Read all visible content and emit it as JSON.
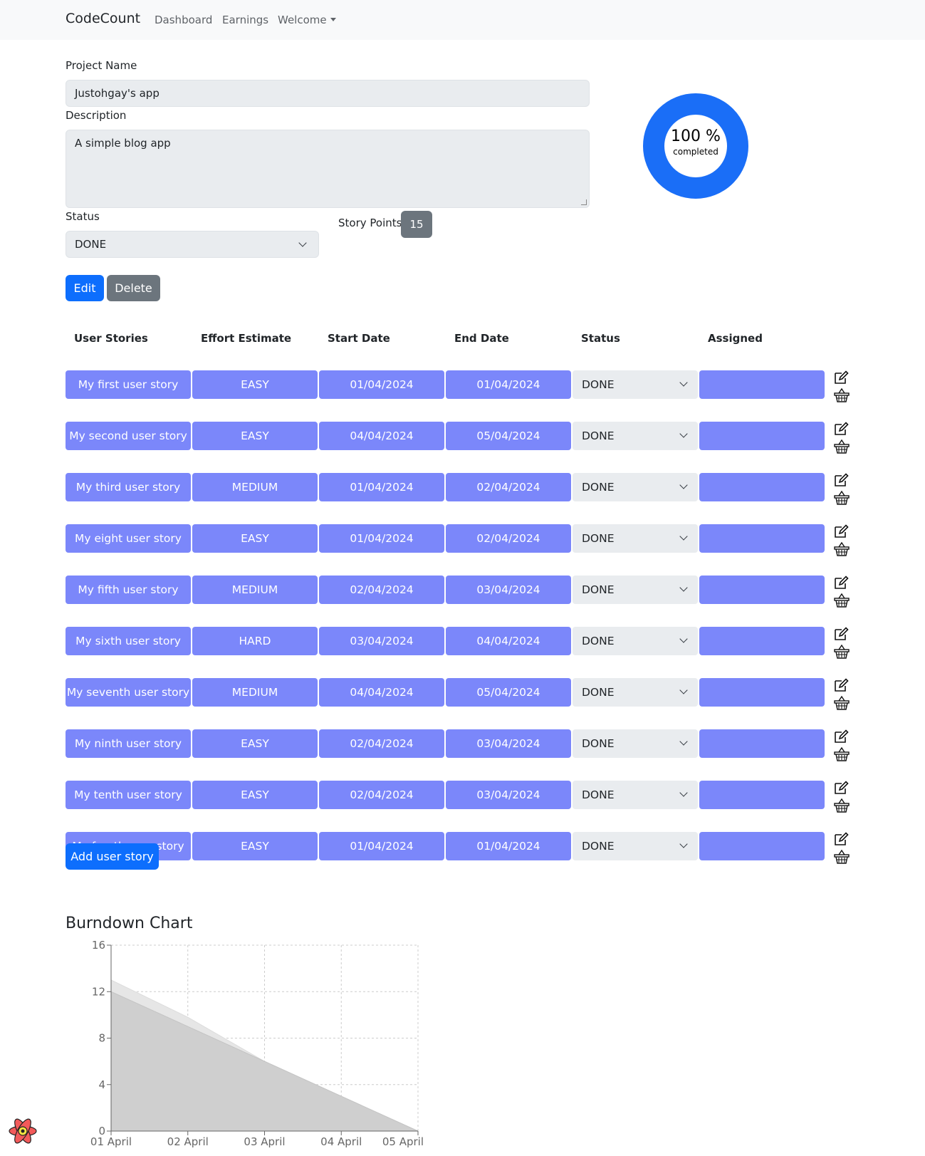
{
  "navbar": {
    "brand": "CodeCount",
    "links": [
      "Dashboard",
      "Earnings"
    ],
    "dropdown": "Welcome"
  },
  "project": {
    "name_label": "Project Name",
    "name_value": "Justohgay's app",
    "description_label": "Description",
    "description_value": "A simple blog app",
    "status_label": "Status",
    "status_value": "DONE",
    "story_points_label": "Story Points",
    "story_points_value": "15",
    "edit_label": "Edit",
    "delete_label": "Delete"
  },
  "progress": {
    "percent": 100,
    "percent_text": "100 %",
    "sub_text": "completed",
    "color": "#1a6ef7"
  },
  "table": {
    "headers": [
      "User Stories",
      "Effort Estimate",
      "Start Date",
      "End Date",
      "Status",
      "Assigned"
    ],
    "rows": [
      {
        "story": "My first user story",
        "effort": "EASY",
        "start": "01/04/2024",
        "end": "01/04/2024",
        "status": "DONE",
        "assigned": ""
      },
      {
        "story": "My second user story",
        "effort": "EASY",
        "start": "04/04/2024",
        "end": "05/04/2024",
        "status": "DONE",
        "assigned": ""
      },
      {
        "story": "My third user story",
        "effort": "MEDIUM",
        "start": "01/04/2024",
        "end": "02/04/2024",
        "status": "DONE",
        "assigned": ""
      },
      {
        "story": "My eight user story",
        "effort": "EASY",
        "start": "01/04/2024",
        "end": "02/04/2024",
        "status": "DONE",
        "assigned": ""
      },
      {
        "story": "My fifth user story",
        "effort": "MEDIUM",
        "start": "02/04/2024",
        "end": "03/04/2024",
        "status": "DONE",
        "assigned": ""
      },
      {
        "story": "My sixth user story",
        "effort": "HARD",
        "start": "03/04/2024",
        "end": "04/04/2024",
        "status": "DONE",
        "assigned": ""
      },
      {
        "story": "My seventh user story",
        "effort": "MEDIUM",
        "start": "04/04/2024",
        "end": "05/04/2024",
        "status": "DONE",
        "assigned": ""
      },
      {
        "story": "My ninth user story",
        "effort": "EASY",
        "start": "02/04/2024",
        "end": "03/04/2024",
        "status": "DONE",
        "assigned": ""
      },
      {
        "story": "My tenth user story",
        "effort": "EASY",
        "start": "02/04/2024",
        "end": "03/04/2024",
        "status": "DONE",
        "assigned": ""
      },
      {
        "story": "My fourth user story",
        "effort": "EASY",
        "start": "01/04/2024",
        "end": "01/04/2024",
        "status": "DONE",
        "assigned": ""
      }
    ],
    "row_icons": [
      "edit-icon",
      "basket-icon"
    ],
    "add_label": "Add user story"
  },
  "chart_data": {
    "type": "area",
    "title": "Burndown Chart",
    "x": [
      "01 April",
      "02 April",
      "03 April",
      "04 April",
      "05 April"
    ],
    "series": [
      {
        "values": [
          13,
          9.8,
          6,
          3,
          0
        ],
        "color": "#e6e6e6"
      },
      {
        "values": [
          12,
          9,
          6,
          3,
          0
        ],
        "color": "#cfcfcf"
      }
    ],
    "yticks": [
      0,
      4,
      8,
      12,
      16
    ],
    "ylim": [
      0,
      16
    ],
    "grid": true
  }
}
